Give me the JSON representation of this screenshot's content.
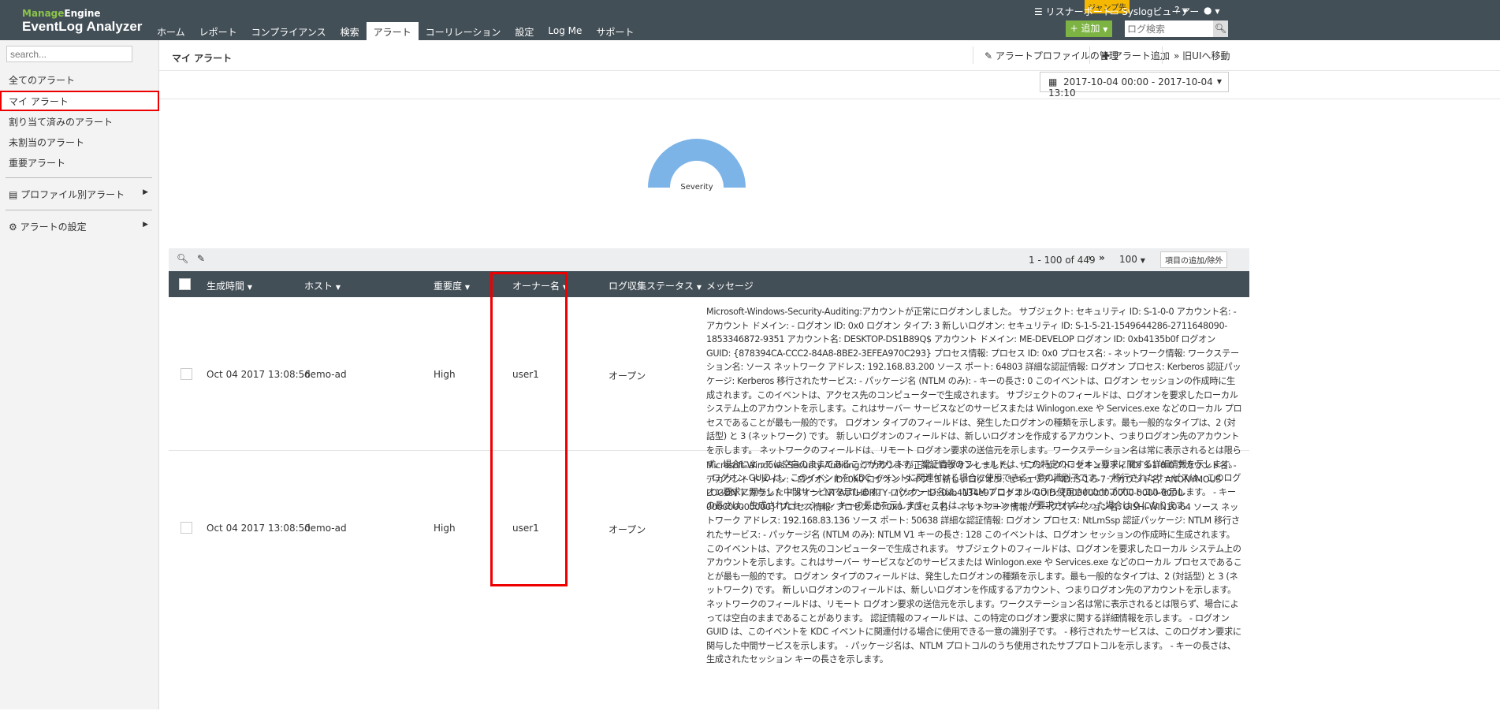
{
  "header": {
    "brand_top_a": "Manage",
    "brand_top_b": "Engine",
    "brand": "EventLog Analyzer",
    "jump": "ジャンプ先",
    "listener_port": "リスナーポート",
    "syslog_viewer": "Syslogビューアー",
    "help": "?",
    "add": "+ 追加",
    "log_search_placeholder": "ログ検索",
    "nav": [
      "ホーム",
      "レポート",
      "コンプライアンス",
      "検索",
      "アラート",
      "コーリレーション",
      "設定",
      "Log Me",
      "サポート"
    ]
  },
  "sidebar": {
    "search_placeholder": "search...",
    "items": [
      "全てのアラート",
      "マイ アラート",
      "割り当て済みのアラート",
      "未割当のアラート",
      "重要アラート"
    ],
    "profile_alerts": "プロファイル別アラート",
    "alert_settings": "アラートの設定"
  },
  "page": {
    "title": "マイ アラート",
    "manage_profiles": "アラートプロファイルの管理",
    "add_alert": "アラート追加",
    "old_ui": "旧UIへ移動",
    "date_range": "2017-10-04 00:00 - 2017-10-04 13:10",
    "gauge_label": "Severity"
  },
  "table": {
    "pagination": "1 - 100 of 449",
    "page_size": "100",
    "columns_button": "項目の追加/除外",
    "columns": [
      "生成時間",
      "ホスト",
      "重要度",
      "オーナー名",
      "ログ収集ステータス",
      "メッセージ"
    ],
    "rows": [
      {
        "time": "Oct 04 2017 13:08:56",
        "host": "demo-ad",
        "severity": "High",
        "owner": "user1",
        "status": "オープン",
        "message": "Microsoft-Windows-Security-Auditing:アカウントが正常にログオンしました。 サブジェクト: セキュリティ ID: S-1-0-0 アカウント名: - アカウント ドメイン: - ログオン ID: 0x0 ログオン タイプ: 3 新しいログオン: セキュリティ ID: S-1-5-21-1549644286-2711648090-1853346872-9351 アカウント名: DESKTOP-DS1B89Q$ アカウント ドメイン: ME-DEVELOP ログオン ID: 0xb4135b0f ログオン GUID: {878394CA-CCC2-84A8-8BE2-3EFEA970C293} プロセス情報: プロセス ID: 0x0 プロセス名: - ネットワーク情報: ワークステーション名: ソース ネットワーク アドレス: 192.168.83.200 ソース ポート: 64803 詳細な認証情報: ログオン プロセス: Kerberos 認証パッケージ: Kerberos 移行されたサービス: - パッケージ名 (NTLM のみ): - キーの長さ: 0 このイベントは、ログオン セッションの作成時に生成されます。このイベントは、アクセス先のコンピューターで生成されます。 サブジェクトのフィールドは、ログオンを要求したローカル システム上のアカウントを示します。これはサーバー サービスなどのサービスまたは Winlogon.exe や Services.exe などのローカル プロセスであることが最も一般的です。 ログオン タイプのフィールドは、発生したログオンの種類を示します。最も一般的なタイプは、2 (対話型) と 3 (ネットワーク) です。 新しいログオンのフィールドは、新しいログオンを作成するアカウント、つまりログオン先のアカウントを示します。 ネットワークのフィールドは、リモート ログオン要求の送信元を示します。ワークステーション名は常に表示されるとは限らず、場合によっては空白のままであることがあります。 認証情報のフィールドは、この特定のログオン要求に関する詳細情報を示します。 - ログオン GUID は、このイベントを KDC イベントに関連付ける場合に使用できる一意の識別子です。 - 移行されたサービスは、このログオン要求に関与した中間サービスを示します。 - パッケージ名は、NTLM プロトコルのうち使用されたサブプロトコルを示します。 - キーの長さは、生成されたセッション キーの長さを示します。これは、セッション キーが要求されなかった場合は 0 になります。"
      },
      {
        "time": "Oct 04 2017 13:08:50",
        "host": "demo-ad",
        "severity": "High",
        "owner": "user1",
        "status": "オープン",
        "message": "Microsoft-Windows-Security-Auditing:アカウントが正常にログオンしました。 サブジェクト: セキュリティ ID: S-1-0-0 アカウント名: - アカウント ドメイン: - ログオン ID: 0x0 ログオン タイプ: 3 新しいログオン: セキュリティ ID: S-1-5-7 アカウント名: ANONYMOUS LOGON アカウント ドメイン: NT AUTHORITY ログオン ID: 0xb4134e97 ログオン GUID: {00000000-0000-0000-0000-000000000000} プロセス情報: プロセス ID: 0x0 プロセス名: - ネットワーク情報: ワークステーション名: OISHI-WIN10-64 ソース ネットワーク アドレス: 192.168.83.136 ソース ポート: 50638 詳細な認証情報: ログオン プロセス: NtLmSsp 認証パッケージ: NTLM 移行されたサービス: - パッケージ名 (NTLM のみ): NTLM V1 キーの長さ: 128 このイベントは、ログオン セッションの作成時に生成されます。このイベントは、アクセス先のコンピューターで生成されます。 サブジェクトのフィールドは、ログオンを要求したローカル システム上のアカウントを示します。これはサーバー サービスなどのサービスまたは Winlogon.exe や Services.exe などのローカル プロセスであることが最も一般的です。 ログオン タイプのフィールドは、発生したログオンの種類を示します。最も一般的なタイプは、2 (対話型) と 3 (ネットワーク) です。 新しいログオンのフィールドは、新しいログオンを作成するアカウント、つまりログオン先のアカウントを示します。 ネットワークのフィールドは、リモート ログオン要求の送信元を示します。ワークステーション名は常に表示されるとは限らず、場合によっては空白のままであることがあります。 認証情報のフィールドは、この特定のログオン要求に関する詳細情報を示します。 - ログオン GUID は、このイベントを KDC イベントに関連付ける場合に使用できる一意の識別子です。 - 移行されたサービスは、このログオン要求に関与した中間サービスを示します。 - パッケージ名は、NTLM プロトコルのうち使用されたサブプロトコルを示します。 - キーの長さは、生成されたセッション キーの長さを示します。"
      }
    ]
  }
}
